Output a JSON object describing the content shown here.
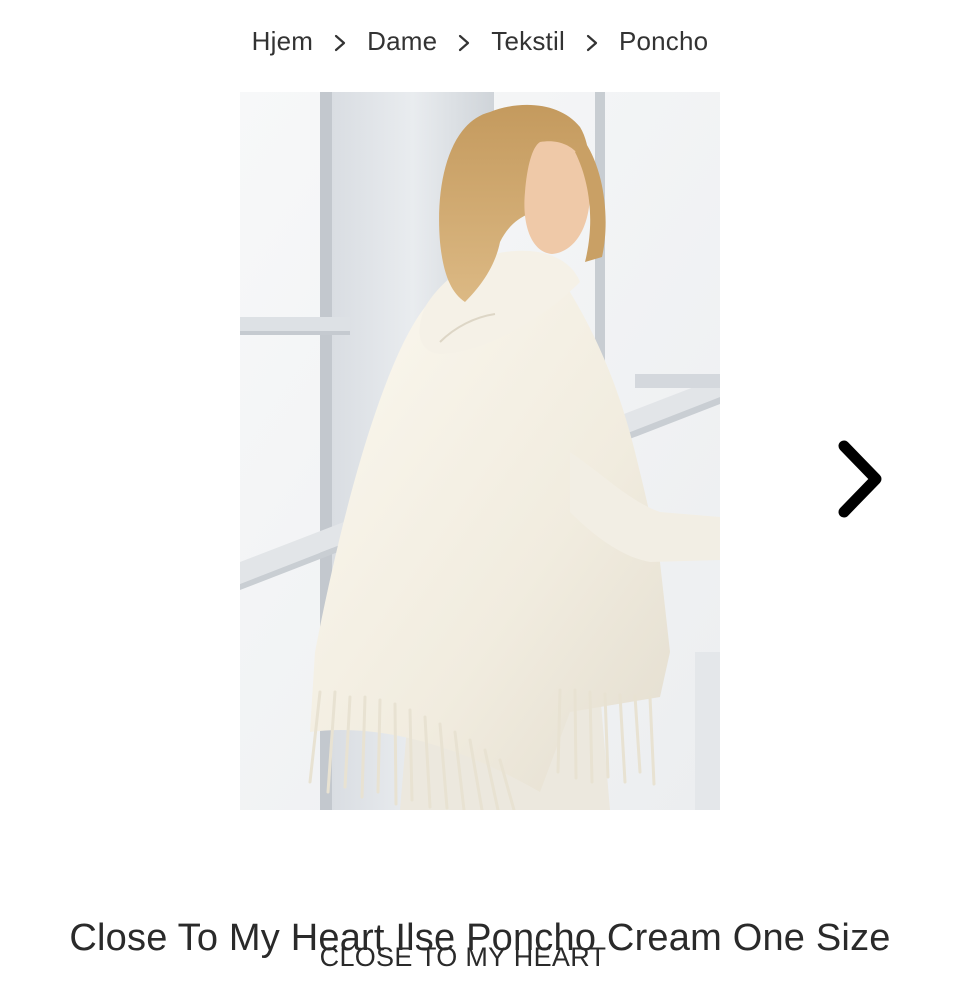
{
  "breadcrumb": {
    "items": [
      {
        "label": "Hjem"
      },
      {
        "label": "Dame"
      },
      {
        "label": "Tekstil"
      },
      {
        "label": "Poncho"
      }
    ],
    "separator_icon": "chevron-right-icon"
  },
  "gallery": {
    "image_count": 2,
    "active_index": 0,
    "next_icon": "chevron-right-icon",
    "dot_active_color": "#4a4a4a",
    "dot_inactive_color": "#a9a9a9"
  },
  "product": {
    "title": "Close To My Heart Ilse Poncho Cream One Size",
    "brand": "CLOSE TO MY HEART"
  }
}
